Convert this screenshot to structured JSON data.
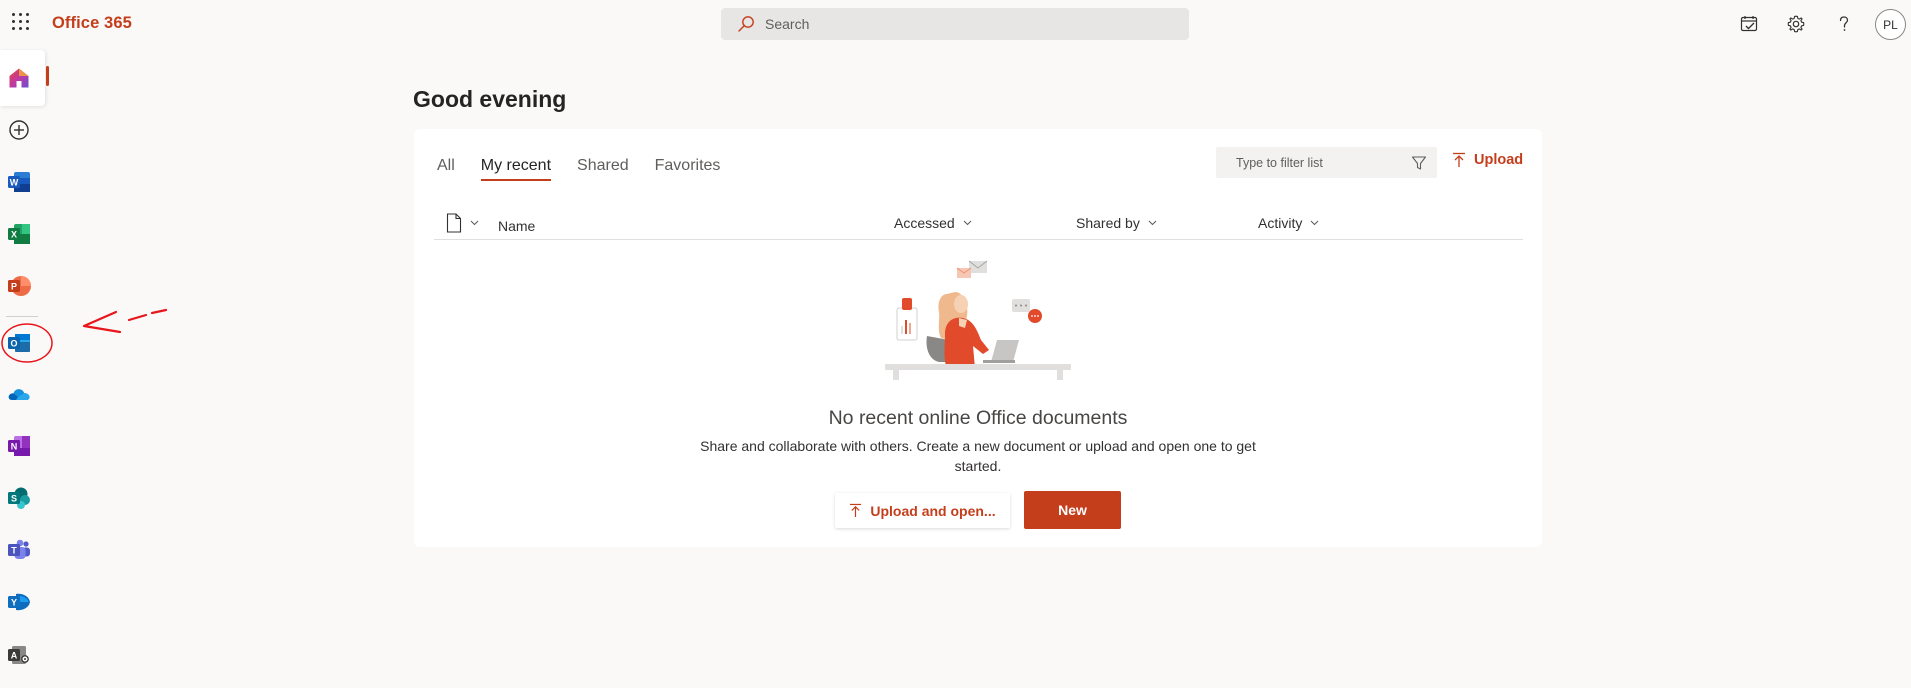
{
  "header": {
    "brand": "Office 365",
    "search_placeholder": "Search",
    "avatar_initials": "PL"
  },
  "rail": {
    "apps": [
      "Home",
      "Create",
      "Word",
      "Excel",
      "PowerPoint",
      "Outlook",
      "OneDrive",
      "OneNote",
      "SharePoint",
      "Teams",
      "Yammer",
      "Admin"
    ],
    "selected": "Home"
  },
  "main": {
    "greeting": "Good evening",
    "tabs": [
      {
        "label": "All"
      },
      {
        "label": "My recent",
        "active": true
      },
      {
        "label": "Shared"
      },
      {
        "label": "Favorites"
      }
    ],
    "filter_placeholder": "Type to filter list",
    "upload_label": "Upload",
    "columns": {
      "name": "Name",
      "accessed": "Accessed",
      "shared_by": "Shared by",
      "activity": "Activity"
    },
    "empty_title": "No recent online Office documents",
    "empty_desc": "Share and collaborate with others. Create a new document or upload and open one to get started.",
    "upload_open_label": "Upload and open...",
    "new_label": "New"
  },
  "colors": {
    "accent": "#c43e1c",
    "background": "#faf9f8",
    "annotation": "#e8151b"
  }
}
